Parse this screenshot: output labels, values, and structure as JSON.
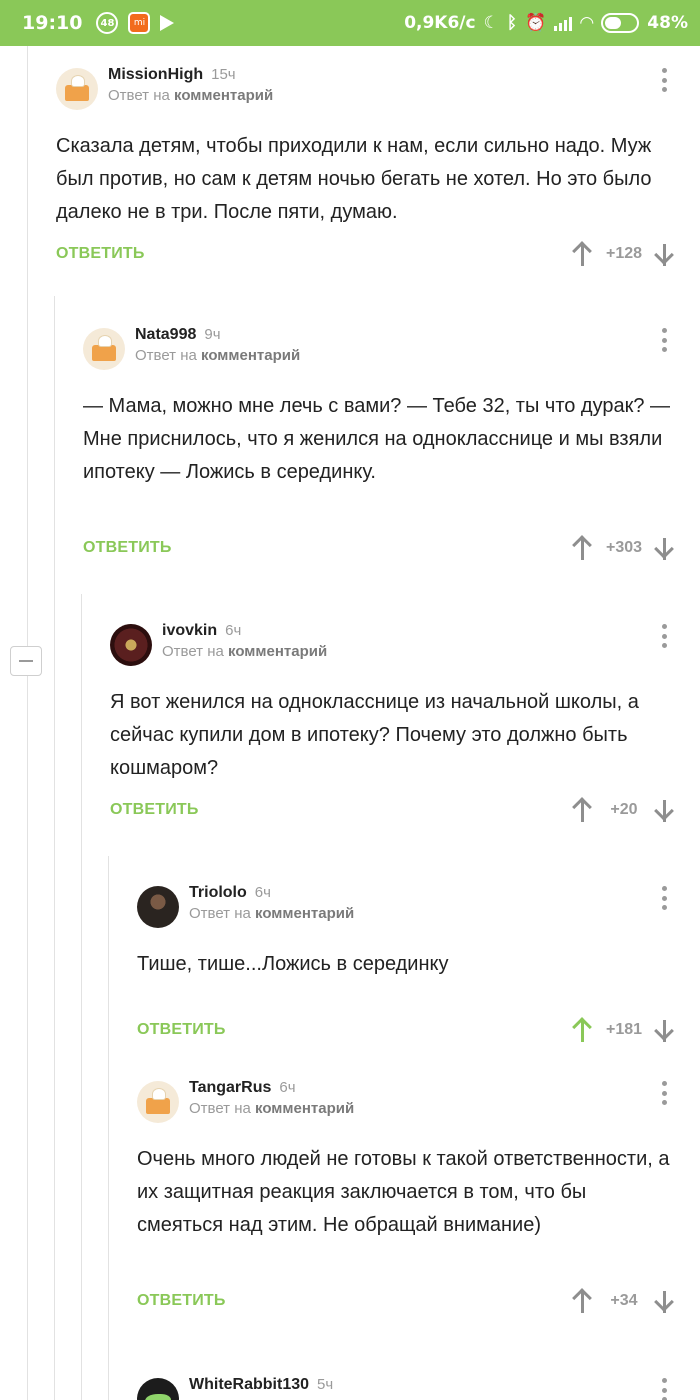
{
  "status_bar": {
    "time": "19:10",
    "badge": "48",
    "mi_label": "mi",
    "speed": "0,9K6/c",
    "battery": "48%",
    "icons": [
      "moon-icon",
      "bluetooth-icon",
      "alarm-icon",
      "signal-icon",
      "wifi-icon",
      "battery-icon"
    ]
  },
  "colors": {
    "accent": "#8ac858",
    "muted": "#9a9a9a"
  },
  "reply_prefix": "Ответ на",
  "reply_target": "комментарий",
  "reply_button": "ОТВЕТИТЬ",
  "comments": [
    {
      "user": "MissionHigh",
      "time": "15ч",
      "text": "Сказала детям, чтобы приходили к нам, если сильно надо. Муж был против, но сам к детям ночью бегать не хотел. Но это было далеко не в три. После пяти, думаю.",
      "score": "+128",
      "avatar": "cheese-house-avatar",
      "upvoted": false
    },
    {
      "user": "Nata998",
      "time": "9ч",
      "text": "— Мама, можно мне лечь с вами? — Тебе 32, ты что дурак? — Мне приснилось, что я женился на однокласснице и мы взяли ипотеку — Ложись в серединку.",
      "score": "+303",
      "avatar": "cheese-house-avatar",
      "upvoted": false
    },
    {
      "user": "ivovkin",
      "time": "6ч",
      "text": "Я вот женился на однокласснице из начальной школы, а сейчас купили дом в ипотеку? Почему это должно быть кошмаром?",
      "score": "+20",
      "avatar": "coin-avatar",
      "upvoted": false
    },
    {
      "user": "Triololo",
      "time": "6ч",
      "text": "Тише, тише...Ложись в серединку",
      "score": "+181",
      "avatar": "photo-avatar",
      "upvoted": true
    },
    {
      "user": "TangarRus",
      "time": "6ч",
      "text": "Очень много людей не готовы к такой ответственности, а их защитная реакция заключается в том, что бы смеяться над этим. Не обращай внимание)",
      "score": "+34",
      "avatar": "cheese-house-avatar",
      "upvoted": false
    },
    {
      "user": "WhiteRabbit130",
      "time": "5ч",
      "avatar": "rabbit-avatar"
    }
  ]
}
